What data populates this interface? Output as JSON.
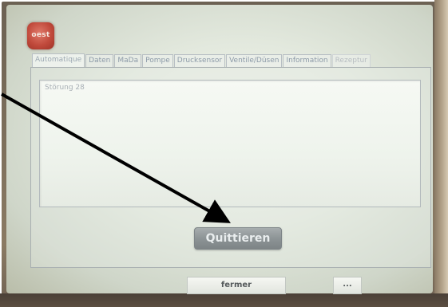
{
  "logo": {
    "text": "oest"
  },
  "tabs": [
    {
      "label": "Automatique",
      "active": true
    },
    {
      "label": "Daten",
      "active": false
    },
    {
      "label": "MaDa",
      "active": false
    },
    {
      "label": "Pompe",
      "active": false
    },
    {
      "label": "Drucksensor",
      "active": false
    },
    {
      "label": "Ventile/Düsen",
      "active": false
    },
    {
      "label": "Information",
      "active": false
    },
    {
      "label": "Rezeptur",
      "active": false
    }
  ],
  "message": {
    "text": "Störung 28"
  },
  "buttons": {
    "quit_label": "Quittieren",
    "close_label": "fermer",
    "more_label": "..."
  },
  "colors": {
    "logo": "#c14a3c",
    "arrow": "#000000",
    "screen_bg": "#e3e9de",
    "button_gray": "#8d9496"
  }
}
